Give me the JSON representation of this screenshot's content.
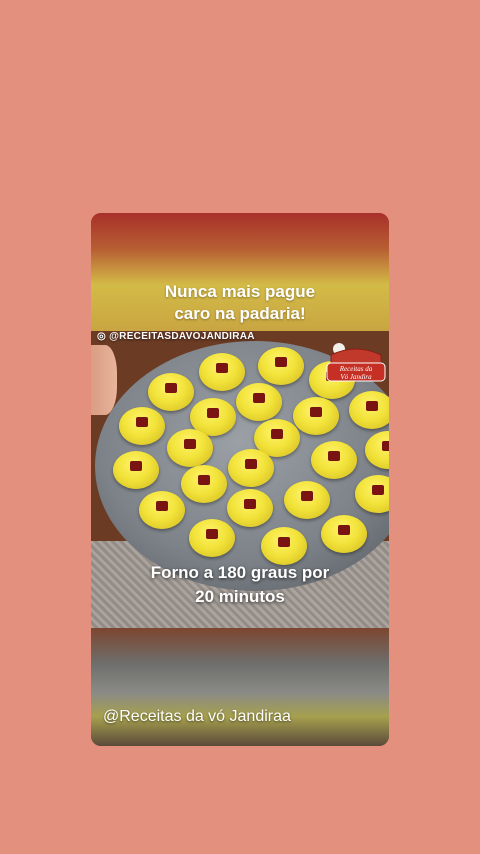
{
  "story": {
    "headline_line1": "Nunca mais pague",
    "headline_line2": "caro na padaria!",
    "instagram_handle": "@RECEITASDAVOJANDIRAA",
    "logo_text_line1": "Receitas da",
    "logo_text_line2": "Vó Jandira",
    "caption_line1": "Forno a 180 graus por",
    "caption_line2": "20 minutos",
    "author_handle": "@Receitas da vó Jandiraa"
  },
  "colors": {
    "page_background": "#e3917e",
    "cookie": "#f2e33a",
    "guava": "#7a1413"
  }
}
